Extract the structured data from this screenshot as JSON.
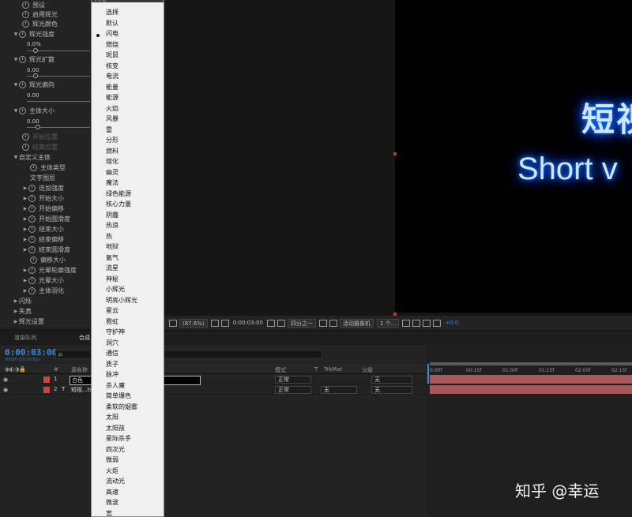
{
  "effect_controls": {
    "preset_label": "预设",
    "preset_value": "闪电",
    "properties": [
      {
        "label": "启用辉光"
      },
      {
        "label": "辉光颜色"
      },
      {
        "label": "辉光强度",
        "value": "0.0%"
      },
      {
        "label": "辉光扩散",
        "value": "0.00"
      },
      {
        "label": "辉光偏向",
        "value": "0.00"
      },
      {
        "label": "主体大小",
        "value": "0.00"
      },
      {
        "label": "开始位置"
      },
      {
        "label": "结束位置"
      },
      {
        "label": "自定义主体"
      },
      {
        "label": "主体类型"
      },
      {
        "label": "文字图层"
      },
      {
        "label": "迭加强度"
      },
      {
        "label": "开始大小"
      },
      {
        "label": "开始偏移"
      },
      {
        "label": "开始圆滑度"
      },
      {
        "label": "结束大小"
      },
      {
        "label": "结束偏移"
      },
      {
        "label": "结束圆滑度"
      },
      {
        "label": "偏移大小"
      },
      {
        "label": "光晕轮廓强度"
      },
      {
        "label": "光晕大小"
      },
      {
        "label": "主体羽化"
      },
      {
        "label": "闪烁"
      },
      {
        "label": "失真"
      },
      {
        "label": "辉光设置"
      }
    ]
  },
  "dropdown": {
    "options": [
      "选择",
      "默认",
      "闪电",
      "燃烧",
      "斑鼠",
      "核变",
      "电流",
      "能量",
      "能源",
      "火焰",
      "风暴",
      "雷",
      "分形",
      "燃料",
      "熔化",
      "幽灵",
      "魔法",
      "绿色能源",
      "核心力量",
      "阴霾",
      "热浪",
      "热",
      "地狱",
      "氤气",
      "流星",
      "神秘",
      "小辉光",
      "明亮小辉光",
      "星云",
      "霓虹",
      "守护神",
      "洞穴",
      "通信",
      "质子",
      "脉冲",
      "杀人魔",
      "简单爆色",
      "柔软的烟雾",
      "太阳",
      "太阳孩",
      "星际杀手",
      "四次光",
      "微弱",
      "火炬",
      "流动光",
      "高速",
      "微波",
      "宽"
    ],
    "selected": "闪电"
  },
  "viewer": {
    "text_line1": "短视",
    "text_line2": "Short v",
    "zoom": "(87.6%)",
    "timecode": "0:00:03:00",
    "resolution": "四分之一",
    "camera": "活动摄像机",
    "views": "1 个...",
    "exposure": "+0.0"
  },
  "timeline": {
    "tab_render": "渲染队列",
    "tab_comp": "合成",
    "timecode": "0:00:03:00",
    "timecode_sub": "00090 (30.00 fps)",
    "search_icon": "ρ.",
    "headers": {
      "num": "#",
      "name": "源名称",
      "mode": "模式",
      "trkmat": "TrkMat",
      "parent": "父级",
      "t": "T"
    },
    "layers": [
      {
        "num": "1",
        "type": "□",
        "name": "白色",
        "mode": "正常",
        "trkmat": "",
        "parent": "无"
      },
      {
        "num": "2",
        "type": "T",
        "name": "短视...ts",
        "mode": "正常",
        "trkmat": "无",
        "parent": "无"
      }
    ],
    "ruler": [
      "0:00f",
      "00:15f",
      "01:00f",
      "01:15f",
      "02:00f",
      "02:15f"
    ]
  },
  "watermark": "知乎 @幸运",
  "colors": {
    "accent": "#3d8bd9",
    "layer_bar": "#a85858",
    "glow": "#1e7bff"
  }
}
